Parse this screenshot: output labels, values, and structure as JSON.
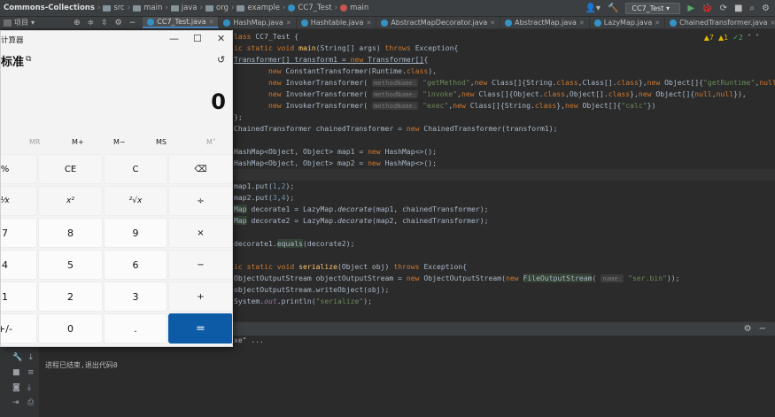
{
  "ide": {
    "breadcrumbs": [
      "Commons-Collections",
      "src",
      "main",
      "java",
      "org",
      "example",
      "CC7_Test",
      "main"
    ],
    "run_config": "CC7_Test",
    "project_tab": "项目",
    "tabs": [
      "CC7_Test.java",
      "HashMap.java",
      "Hashtable.java",
      "AbstractMapDecorator.java",
      "AbstractMap.java",
      "LazyMap.java",
      "ChainedTransformer.java"
    ],
    "inspections": {
      "warnings": "7",
      "weak": "1",
      "ok": "2"
    },
    "hint_partial": "xe\" ...",
    "console_output": "进程已结束,退出代码0"
  },
  "calculator": {
    "title": "计算器",
    "mode": "标准",
    "display": "0",
    "memory": [
      "MR",
      "M+",
      "M−",
      "MS",
      "M˅"
    ],
    "keys": [
      [
        "%",
        "CE",
        "C",
        "⌫"
      ],
      [
        "¹⁄x",
        "x²",
        "²√x",
        "÷"
      ],
      [
        "7",
        "8",
        "9",
        "×"
      ],
      [
        "4",
        "5",
        "6",
        "−"
      ],
      [
        "1",
        "2",
        "3",
        "+"
      ],
      [
        "+/-",
        "0",
        ".",
        "="
      ]
    ]
  },
  "colors": {
    "ide_bg": "#2b2b2b",
    "keyword": "#cc7832",
    "string": "#6a8759",
    "accent": "#0d5aa7"
  }
}
